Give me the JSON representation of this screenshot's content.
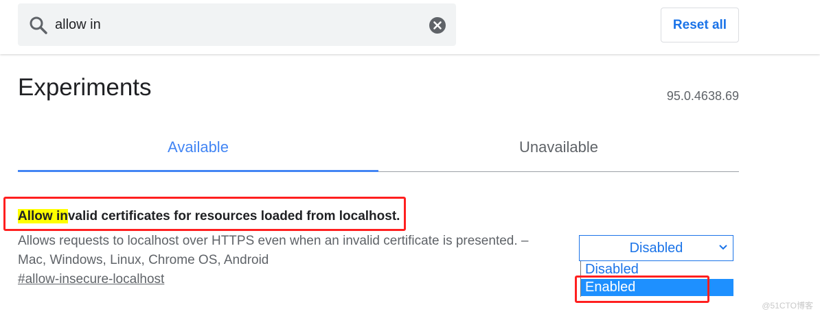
{
  "search": {
    "value": "allow in",
    "icon": "search-icon",
    "clear_icon": "clear-icon"
  },
  "header": {
    "reset_label": "Reset all"
  },
  "page": {
    "title": "Experiments",
    "version": "95.0.4638.69"
  },
  "tabs": [
    {
      "label": "Available",
      "active": true
    },
    {
      "label": "Unavailable",
      "active": false
    }
  ],
  "experiment": {
    "title_highlight": "Allow in",
    "title_rest": "valid certificates for resources loaded from localhost.",
    "description": "Allows requests to localhost over HTTPS even when an invalid certificate is presented. – Mac, Windows, Linux, Chrome OS, Android",
    "link": "#allow-insecure-localhost",
    "selected_value": "Disabled",
    "options": [
      "Disabled",
      "Enabled"
    ],
    "highlighted_option": "Enabled"
  },
  "watermark": "@51CTO博客",
  "colors": {
    "accent": "#1a73e8",
    "tab_active": "#4285f4",
    "highlight": "#ffff00",
    "annotation_red": "#ff1f1f",
    "option_selected_bg": "#1e90ff"
  }
}
